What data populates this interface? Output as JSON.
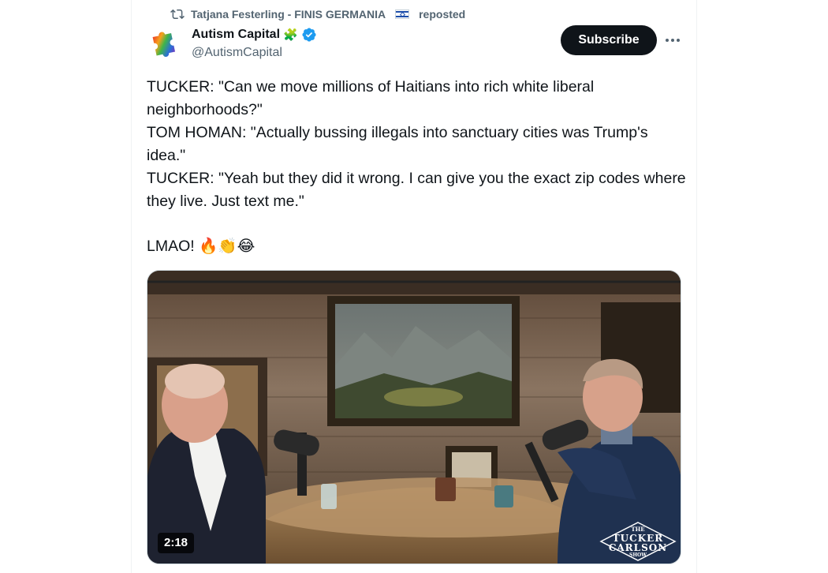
{
  "repost": {
    "reposter": "Tatjana Festerling - FINIS GERMANIA",
    "reposter_flag": "flag-israel-icon",
    "suffix": "reposted"
  },
  "author": {
    "name": "Autism Capital",
    "handle": "@AutismCapital",
    "name_emoji": "🧩",
    "verified": true
  },
  "actions": {
    "subscribe_label": "Subscribe"
  },
  "tweet": {
    "lines": [
      "TUCKER: \"Can we move millions of Haitians into rich white liberal neighborhoods?\"",
      "TOM HOMAN: \"Actually bussing illegals into sanctuary cities was Trump's idea.\"",
      "TUCKER: \"Yeah but they did it wrong. I can give you the exact zip codes where they live. Just text me.\""
    ],
    "closing": "LMAO! 🔥👏😂"
  },
  "media": {
    "duration": "2:18",
    "watermark_top": "THE",
    "watermark_line1": "TUCKER",
    "watermark_line2": "CARLSON",
    "watermark_bottom": "SHOW"
  },
  "colors": {
    "text": "#0f1419",
    "secondary": "#536471",
    "verified": "#1d9bf0",
    "button": "#0f1419"
  }
}
